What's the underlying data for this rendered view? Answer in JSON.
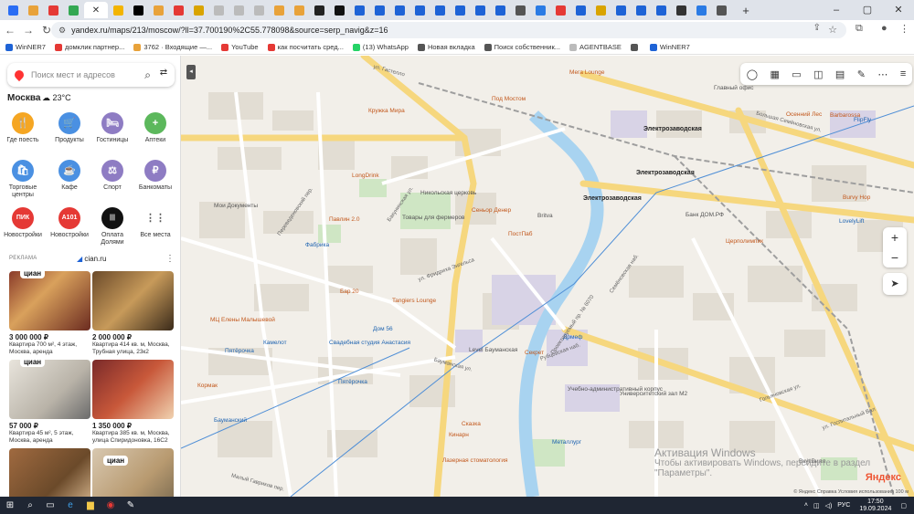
{
  "browser": {
    "active_tab_close": "✕",
    "new_tab": "+",
    "window_controls": [
      "–",
      "▢",
      "✕"
    ],
    "tabs_favicon_colors": [
      "#2a6df4",
      "#e8a23a",
      "#e53935",
      "#34a853",
      "#f3b400",
      "#000000",
      "#e8a23a",
      "#e53935",
      "#d9a400",
      "#bbbbbb",
      "#bbbbbb",
      "#bbbbbb",
      "#e8a23a",
      "#e8a23a",
      "#222222",
      "#111111",
      "#1e63d6",
      "#1e63d6",
      "#1e63d6",
      "#1e63d6",
      "#1e63d6",
      "#1e63d6",
      "#1e63d6",
      "#1e63d6",
      "#555555",
      "#2b7be4",
      "#e53935",
      "#1e63d6",
      "#d9a400",
      "#1e63d6",
      "#1e63d6",
      "#1e63d6",
      "#333333",
      "#2b7be4",
      "#555555"
    ],
    "url": "yandex.ru/maps/213/moscow/?ll=37.700190%2C55.778098&source=serp_navig&z=16",
    "bookmarks": [
      {
        "label": "WinNER7",
        "color": "#1e63d6"
      },
      {
        "label": "домклик партнер...",
        "color": "#e53935"
      },
      {
        "label": "3762 · Входящие —...",
        "color": "#e8a23a"
      },
      {
        "label": "YouTube",
        "color": "#e53935"
      },
      {
        "label": "как посчитать сред...",
        "color": "#e53935"
      },
      {
        "label": "(13) WhatsApp",
        "color": "#25d366"
      },
      {
        "label": "Новая вкладка",
        "color": "#555555"
      },
      {
        "label": "Поиск собственник...",
        "color": "#555555"
      },
      {
        "label": "AGENTBASE",
        "color": "#bbbbbb"
      },
      {
        "label": "",
        "color": "#555555"
      },
      {
        "label": "WinNER7",
        "color": "#1e63d6"
      }
    ]
  },
  "sidebar": {
    "search_placeholder": "Поиск мест и адресов",
    "city": "Москва",
    "temperature": "23°C",
    "categories": [
      {
        "label": "Где поесть",
        "icon": "fork-icon",
        "color": "#f5a623",
        "glyph": "🍴"
      },
      {
        "label": "Продукты",
        "icon": "basket-icon",
        "color": "#4a90e2",
        "glyph": "🛒"
      },
      {
        "label": "Гостиницы",
        "icon": "bed-icon",
        "color": "#8e7cc3",
        "glyph": "🛏"
      },
      {
        "label": "Аптеки",
        "icon": "plus-icon",
        "color": "#5cb85c",
        "glyph": "+"
      },
      {
        "label": "Торговые центры",
        "icon": "bag-icon",
        "color": "#4a90e2",
        "glyph": "🛍"
      },
      {
        "label": "Кафе",
        "icon": "cup-icon",
        "color": "#4a90e2",
        "glyph": "☕"
      },
      {
        "label": "Спорт",
        "icon": "dumbbell-icon",
        "color": "#8e7cc3",
        "glyph": "⚖"
      },
      {
        "label": "Банкоматы",
        "icon": "ruble-icon",
        "color": "#8e7cc3",
        "glyph": "₽"
      },
      {
        "label": "Новостройки",
        "icon": "pik-logo",
        "color": "#e53935",
        "glyph": "ПИК"
      },
      {
        "label": "Новостройки",
        "icon": "a101-logo",
        "color": "#e53935",
        "glyph": "A101"
      },
      {
        "label": "Оплата Долями",
        "icon": "dolyami-logo",
        "color": "#111111",
        "glyph": "|||"
      },
      {
        "label": "Все места",
        "icon": "grid-icon",
        "color": "#ffffff",
        "glyph": "⋮⋮"
      }
    ],
    "ad_label": "РЕКЛАМА",
    "ad_source": "cian.ru",
    "listings": [
      {
        "price": "3 000 000 ₽",
        "desc": "Квартира 700 м², 4 этаж, Москва, аренда",
        "tag": "циан"
      },
      {
        "price": "2 000 000 ₽",
        "desc": "Квартира 414 кв. м, Москва, Трубная улица, 23к2",
        "tag": ""
      },
      {
        "price": "57 000 ₽",
        "desc": "Квартира 45 м², 5 этаж, Москва, аренда",
        "tag": "циан"
      },
      {
        "price": "1 350 000 ₽",
        "desc": "Квартира 385 кв. м, Москва, улица Спиридоновка, 16С2",
        "tag": ""
      },
      {
        "price": "",
        "desc": "",
        "tag": ""
      },
      {
        "price": "",
        "desc": "",
        "tag": "циан"
      }
    ]
  },
  "map": {
    "labels": [
      {
        "text": "ул. Гастелло",
        "cls": "street"
      },
      {
        "text": "Мега Lounge",
        "cls": "poi"
      },
      {
        "text": "Под Мостом",
        "cls": "poi"
      },
      {
        "text": "Кружка Мира",
        "cls": "poi"
      },
      {
        "text": "Электрозаводская",
        "cls": "metro"
      },
      {
        "text": "Электрозаводская",
        "cls": "metro"
      },
      {
        "text": "Электрозаводская",
        "cls": "metro"
      },
      {
        "text": "Большая Семёновская ул.",
        "cls": "street"
      },
      {
        "text": "Главный офис",
        "cls": ""
      },
      {
        "text": "Осенний Лес",
        "cls": "poi"
      },
      {
        "text": "Barbarossa",
        "cls": "poi"
      },
      {
        "text": "FlipFly",
        "cls": "blue"
      },
      {
        "text": "LongDrink",
        "cls": "poi"
      },
      {
        "text": "Никольская церковь",
        "cls": ""
      },
      {
        "text": "Мои Документы",
        "cls": ""
      },
      {
        "text": "Сеньор Денер",
        "cls": "poi"
      },
      {
        "text": "Britva",
        "cls": ""
      },
      {
        "text": "Товары для фермеров",
        "cls": ""
      },
      {
        "text": "Павлин 2.0",
        "cls": "poi"
      },
      {
        "text": "Фабрика",
        "cls": "blue"
      },
      {
        "text": "ПостПаб",
        "cls": "poi"
      },
      {
        "text": "Банк ДОМ.РФ",
        "cls": ""
      },
      {
        "text": "Церполимпик",
        "cls": "poi"
      },
      {
        "text": "Burvy Hop",
        "cls": "poi"
      },
      {
        "text": "LovelyLift",
        "cls": "blue"
      },
      {
        "text": "Tangiers Lounge",
        "cls": "poi"
      },
      {
        "text": "Бар 20",
        "cls": "poi"
      },
      {
        "text": "Дом 56",
        "cls": "blue"
      },
      {
        "text": "Level Бауманская",
        "cls": ""
      },
      {
        "text": "Секрет",
        "cls": "poi"
      },
      {
        "text": "Дрмеф",
        "cls": "blue"
      },
      {
        "text": "МЦ Елены Малышевой",
        "cls": "poi"
      },
      {
        "text": "Пятёрочка",
        "cls": "blue"
      },
      {
        "text": "Камелот",
        "cls": "blue"
      },
      {
        "text": "Свадебная студия Анастасия",
        "cls": "blue"
      },
      {
        "text": "Пятёрочка",
        "cls": "blue"
      },
      {
        "text": "Учебно-административный корпус",
        "cls": ""
      },
      {
        "text": "Университетский зал М2",
        "cls": ""
      },
      {
        "text": "Кормак",
        "cls": "poi"
      },
      {
        "text": "Бауманский",
        "cls": "blue"
      },
      {
        "text": "Сказка",
        "cls": "poi"
      },
      {
        "text": "Кинарн",
        "cls": "poi"
      },
      {
        "text": "Металлург",
        "cls": "blue"
      },
      {
        "text": "Лазерная стоматология",
        "cls": "poi"
      },
      {
        "text": "ВкусВилл",
        "cls": ""
      },
      {
        "text": "Рубцовская наб.",
        "cls": "street"
      },
      {
        "text": "Гольяновская ул.",
        "cls": "street"
      },
      {
        "text": "ул. Госпитальный Вал",
        "cls": "street"
      },
      {
        "text": "Проектируемый пр. № 6070",
        "cls": "street"
      },
      {
        "text": "Малый Гавриков пер.",
        "cls": "street"
      },
      {
        "text": "Бакунинская ул.",
        "cls": "street"
      },
      {
        "text": "Переведеновский пер.",
        "cls": "street"
      },
      {
        "text": "Семёновская наб.",
        "cls": "street"
      },
      {
        "text": "ул. Фридриха Энгельса",
        "cls": "street"
      },
      {
        "text": "Бауманская ул.",
        "cls": "street"
      }
    ],
    "watermark_title": "Активация Windows",
    "watermark_sub": "Чтобы активировать Windows, перейдите в раздел \"Параметры\".",
    "logo": "Яндекс",
    "footer": "© Яндекс   Справка   Условия использования      100 м",
    "toolbar_icons": [
      "layers-icon",
      "traffic-icon",
      "transit-icon",
      "bus-icon",
      "panorama-icon",
      "ruler-icon",
      "more-icon",
      "menu-icon"
    ]
  },
  "taskbar": {
    "time": "17:50",
    "date": "19.09.2024",
    "lang": "РУС"
  }
}
